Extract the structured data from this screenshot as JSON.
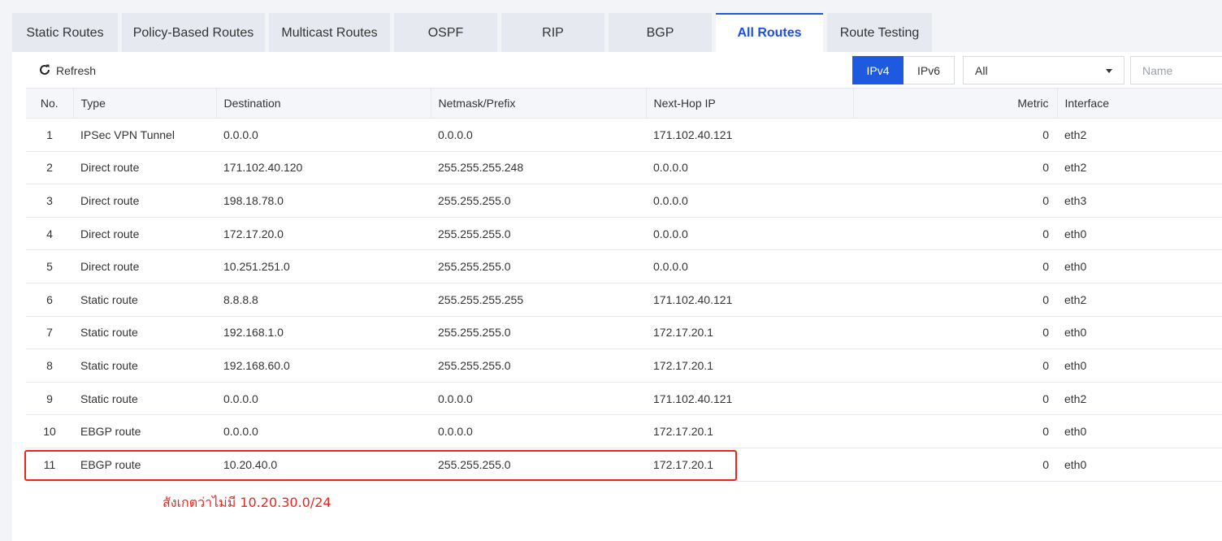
{
  "tabs": [
    {
      "label": "Static Routes",
      "active": false
    },
    {
      "label": "Policy-Based Routes",
      "active": false
    },
    {
      "label": "Multicast Routes",
      "active": false
    },
    {
      "label": "OSPF",
      "active": false
    },
    {
      "label": "RIP",
      "active": false
    },
    {
      "label": "BGP",
      "active": false
    },
    {
      "label": "All Routes",
      "active": true
    },
    {
      "label": "Route Testing",
      "active": false
    }
  ],
  "toolbar": {
    "refresh_label": "Refresh",
    "ipv4_label": "IPv4",
    "ipv6_label": "IPv6",
    "ip_version_selected": "IPv4",
    "filter_value": "All",
    "name_placeholder": "Name"
  },
  "table": {
    "headers": [
      "No.",
      "Type",
      "Destination",
      "Netmask/Prefix",
      "Next-Hop IP",
      "Metric",
      "Interface"
    ],
    "rows": [
      [
        "1",
        "IPSec VPN Tunnel",
        "0.0.0.0",
        "0.0.0.0",
        "171.102.40.121",
        "0",
        "eth2"
      ],
      [
        "2",
        "Direct route",
        "171.102.40.120",
        "255.255.255.248",
        "0.0.0.0",
        "0",
        "eth2"
      ],
      [
        "3",
        "Direct route",
        "198.18.78.0",
        "255.255.255.0",
        "0.0.0.0",
        "0",
        "eth3"
      ],
      [
        "4",
        "Direct route",
        "172.17.20.0",
        "255.255.255.0",
        "0.0.0.0",
        "0",
        "eth0"
      ],
      [
        "5",
        "Direct route",
        "10.251.251.0",
        "255.255.255.0",
        "0.0.0.0",
        "0",
        "eth0"
      ],
      [
        "6",
        "Static route",
        "8.8.8.8",
        "255.255.255.255",
        "171.102.40.121",
        "0",
        "eth2"
      ],
      [
        "7",
        "Static route",
        "192.168.1.0",
        "255.255.255.0",
        "172.17.20.1",
        "0",
        "eth0"
      ],
      [
        "8",
        "Static route",
        "192.168.60.0",
        "255.255.255.0",
        "172.17.20.1",
        "0",
        "eth0"
      ],
      [
        "9",
        "Static route",
        "0.0.0.0",
        "0.0.0.0",
        "171.102.40.121",
        "0",
        "eth2"
      ],
      [
        "10",
        "EBGP route",
        "0.0.0.0",
        "0.0.0.0",
        "172.17.20.1",
        "0",
        "eth0"
      ],
      [
        "11",
        "EBGP route",
        "10.20.40.0",
        "255.255.255.0",
        "172.17.20.1",
        "0",
        "eth0"
      ]
    ]
  },
  "annotation": {
    "note": "สังเกตว่าไม่มี 10.20.30.0/24",
    "color": "#e8261e",
    "highlighted_row": "11"
  },
  "colors": {
    "accent": "#1e5ae0",
    "active_tab_text": "#1e4fd8"
  }
}
